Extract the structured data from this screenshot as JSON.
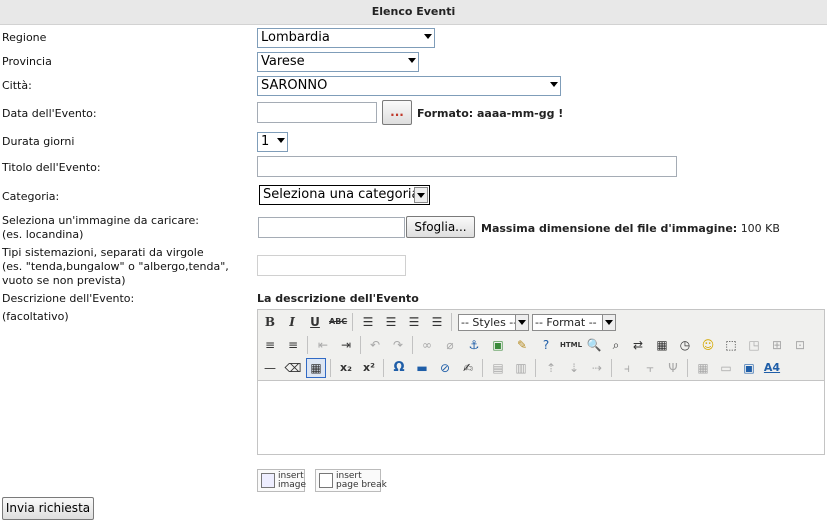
{
  "header": {
    "title": "Elenco Eventi"
  },
  "form": {
    "regione": {
      "label": "Regione",
      "value": "Lombardia"
    },
    "provincia": {
      "label": "Provincia",
      "value": "Varese"
    },
    "citta": {
      "label": "Città:",
      "value": "SARONNO"
    },
    "data": {
      "label": "Data dell'Evento:",
      "value": "",
      "picker_label": "...",
      "format_hint": "Formato: aaaa-mm-gg !"
    },
    "durata": {
      "label": "Durata giorni",
      "value": "1"
    },
    "titolo": {
      "label": "Titolo dell'Evento:",
      "value": ""
    },
    "categoria": {
      "label": "Categoria:",
      "value": "Seleziona una categoria"
    },
    "immagine": {
      "label_line1": "Seleziona un'immagine da caricare:",
      "label_line2": "(es. locandina)",
      "browse_label": "Sfoglia...",
      "max_size_label": "Massima dimensione del file d'immagine:",
      "max_size_value": "100 KB"
    },
    "sistemazioni": {
      "label_line1": "Tipi sistemazioni, separati da virgole",
      "label_line2": "(es. \"tenda,bungalow\" o \"albergo,tenda\",",
      "label_line3": "vuoto se non prevista)",
      "value": ""
    },
    "descrizione": {
      "label_line1": "Descrizione dell'Evento:",
      "label_line2": "(facoltativo)",
      "editor_title": "La descrizione dell'Evento"
    }
  },
  "editor": {
    "styles_select": "-- Styles --",
    "format_select": "-- Format --",
    "html_button": "HTML",
    "omega": "Ω"
  },
  "plugins": {
    "insert_image_line1": "insert",
    "insert_image_line2": "image",
    "page_break_line1": "insert",
    "page_break_line2": "page break"
  },
  "submit": {
    "label": "Invia richiesta"
  }
}
